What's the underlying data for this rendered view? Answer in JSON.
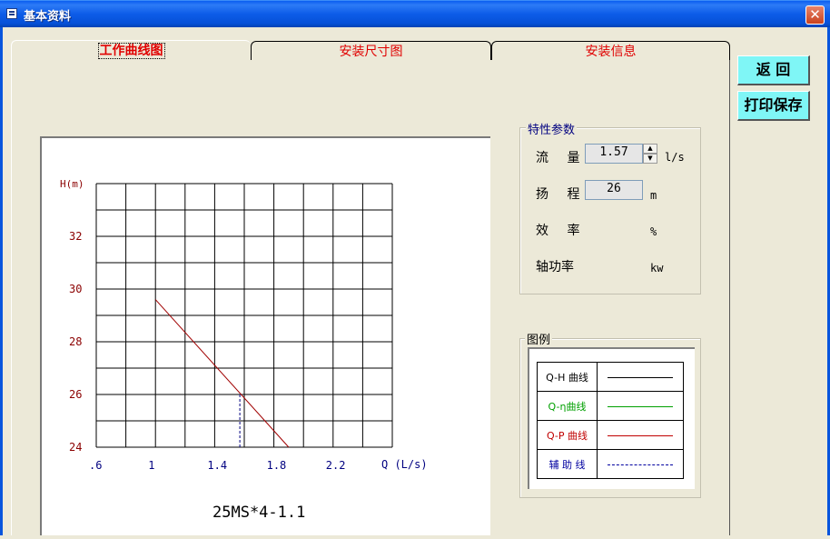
{
  "window": {
    "title": "基本资料",
    "close_symbol": "✕"
  },
  "tabs": [
    {
      "label": "工作曲线图",
      "active": true
    },
    {
      "label": "安装尺寸图",
      "active": false
    },
    {
      "label": "安装信息",
      "active": false
    }
  ],
  "buttons": {
    "back": "返 回",
    "print_save": "打印保存"
  },
  "params": {
    "group_title": "特性参数",
    "flow": {
      "label": "流 量",
      "value": "1.57",
      "unit": "l/s"
    },
    "head": {
      "label": "扬 程",
      "value": "26",
      "unit": "m"
    },
    "efficiency": {
      "label": "效 率",
      "unit": "%"
    },
    "shaft_power": {
      "label": "轴功率",
      "unit": "kw"
    }
  },
  "legend": {
    "title": "图例",
    "items": [
      {
        "name": "Q-H 曲线",
        "color": "#000000",
        "style": "solid"
      },
      {
        "name": "Q-η曲线",
        "color": "#00A000",
        "style": "solid"
      },
      {
        "name": "Q-P 曲线",
        "color": "#C00000",
        "style": "solid"
      },
      {
        "name": "辅 助 线",
        "color": "#0000A0",
        "style": "dashed"
      }
    ]
  },
  "chart_data": {
    "type": "line",
    "model_label": "25MS*4-1.1",
    "ylabel": "H(m)",
    "xlabel": "Q (L/s)",
    "x_ticks": [
      ".6",
      "1",
      "1.4",
      "1.8",
      "2.2"
    ],
    "y_ticks": [
      "32",
      "30",
      "28",
      "26",
      "24"
    ],
    "xlim": [
      0.6,
      2.6
    ],
    "ylim": [
      24,
      34
    ],
    "grid": true,
    "series": [
      {
        "color": "#A00000",
        "x": [
          1.0,
          1.9
        ],
        "y": [
          29.6,
          24.0
        ]
      }
    ],
    "auxiliary": {
      "x": 1.57,
      "y": 26,
      "color": "#000080"
    }
  }
}
